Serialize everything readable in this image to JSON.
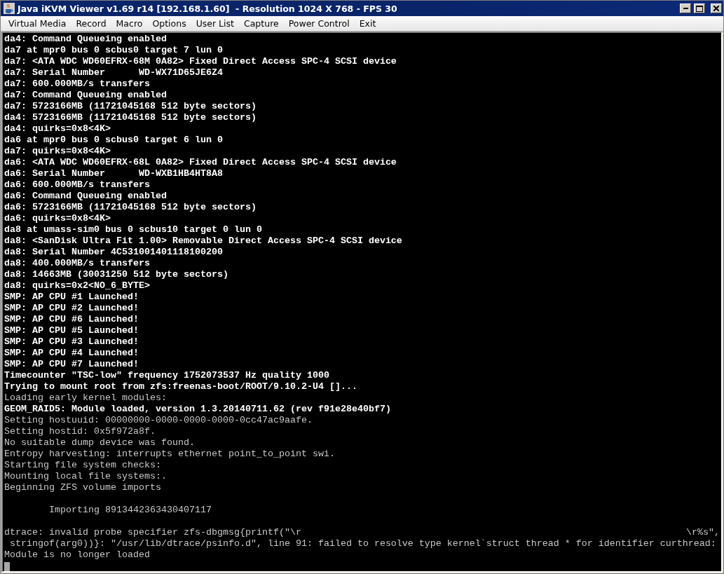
{
  "window": {
    "title": "Java iKVM Viewer v1.69 r14 [192.168.1.60]  - Resolution 1024 X 768 - FPS 30"
  },
  "menu": [
    "Virtual Media",
    "Record",
    "Macro",
    "Options",
    "User List",
    "Capture",
    "Power Control",
    "Exit"
  ],
  "console": {
    "lines": [
      {
        "kind": "bright",
        "text": "da4: Command Queueing enabled"
      },
      {
        "kind": "bright",
        "text": "da7 at mpr0 bus 0 scbus0 target 7 lun 0"
      },
      {
        "kind": "bright",
        "text": "da7: <ATA WDC WD60EFRX-68M 0A82> Fixed Direct Access SPC-4 SCSI device"
      },
      {
        "kind": "bright",
        "text": "da7: Serial Number      WD-WX71D65JE6Z4"
      },
      {
        "kind": "bright",
        "text": "da7: 600.000MB/s transfers"
      },
      {
        "kind": "bright",
        "text": "da7: Command Queueing enabled"
      },
      {
        "kind": "bright",
        "text": "da7: 5723166MB (11721045168 512 byte sectors)"
      },
      {
        "kind": "bright",
        "text": "da4: 5723166MB (11721045168 512 byte sectors)"
      },
      {
        "kind": "bright",
        "text": "da4: quirks=0x8<4K>"
      },
      {
        "kind": "bright",
        "text": "da6 at mpr0 bus 0 scbus0 target 6 lun 0"
      },
      {
        "kind": "bright",
        "text": "da7: quirks=0x8<4K>"
      },
      {
        "kind": "bright",
        "text": "da6: <ATA WDC WD60EFRX-68L 0A82> Fixed Direct Access SPC-4 SCSI device"
      },
      {
        "kind": "bright",
        "text": "da6: Serial Number      WD-WXB1HB4HT8A8"
      },
      {
        "kind": "bright",
        "text": "da6: 600.000MB/s transfers"
      },
      {
        "kind": "bright",
        "text": "da6: Command Queueing enabled"
      },
      {
        "kind": "bright",
        "text": "da6: 5723166MB (11721045168 512 byte sectors)"
      },
      {
        "kind": "bright",
        "text": "da6: quirks=0x8<4K>"
      },
      {
        "kind": "bright",
        "text": "da8 at umass-sim0 bus 0 scbus10 target 0 lun 0"
      },
      {
        "kind": "bright",
        "text": "da8: <SanDisk Ultra Fit 1.00> Removable Direct Access SPC-4 SCSI device"
      },
      {
        "kind": "bright",
        "text": "da8: Serial Number 4C531001401118100200"
      },
      {
        "kind": "bright",
        "text": "da8: 400.000MB/s transfers"
      },
      {
        "kind": "bright",
        "text": "da8: 14663MB (30031250 512 byte sectors)"
      },
      {
        "kind": "bright",
        "text": "da8: quirks=0x2<NO_6_BYTE>"
      },
      {
        "kind": "bright",
        "text": "SMP: AP CPU #1 Launched!"
      },
      {
        "kind": "bright",
        "text": "SMP: AP CPU #2 Launched!"
      },
      {
        "kind": "bright",
        "text": "SMP: AP CPU #6 Launched!"
      },
      {
        "kind": "bright",
        "text": "SMP: AP CPU #5 Launched!"
      },
      {
        "kind": "bright",
        "text": "SMP: AP CPU #3 Launched!"
      },
      {
        "kind": "bright",
        "text": "SMP: AP CPU #4 Launched!"
      },
      {
        "kind": "bright",
        "text": "SMP: AP CPU #7 Launched!"
      },
      {
        "kind": "bright",
        "text": "Timecounter \"TSC-low\" frequency 1752073537 Hz quality 1000"
      },
      {
        "kind": "bright",
        "text": "Trying to mount root from zfs:freenas-boot/ROOT/9.10.2-U4 []..."
      },
      {
        "kind": "dim",
        "text": "Loading early kernel modules:"
      },
      {
        "kind": "bright",
        "text": "GEOM_RAID5: Module loaded, version 1.3.20140711.62 (rev f91e28e40bf7)"
      },
      {
        "kind": "dim",
        "text": "Setting hostuuid: 00000000-0000-0000-0000-0cc47ac9aafe."
      },
      {
        "kind": "dim",
        "text": "Setting hostid: 0x5f972a8f."
      },
      {
        "kind": "dim",
        "text": "No suitable dump device was found."
      },
      {
        "kind": "dim",
        "text": "Entropy harvesting: interrupts ethernet point_to_point swi."
      },
      {
        "kind": "dim",
        "text": "Starting file system checks:"
      },
      {
        "kind": "dim",
        "text": "Mounting local file systems:."
      },
      {
        "kind": "dim",
        "text": "Beginning ZFS volume imports"
      },
      {
        "kind": "blank"
      },
      {
        "kind": "dim",
        "indented": true,
        "text": "Importing 8913442363430407117"
      },
      {
        "kind": "blank"
      },
      {
        "kind": "dim",
        "text": "dtrace: invalid probe specifier zfs-dbgmsg{printf(\"\\r",
        "tail": "\\r%s\","
      },
      {
        "kind": "dim",
        "text": " stringof(arg0))}: \"/usr/lib/dtrace/psinfo.d\", line 91: failed to resolve type kernel`struct thread * for identifier curthread:"
      },
      {
        "kind": "dim",
        "text": "Module is no longer loaded"
      }
    ]
  }
}
